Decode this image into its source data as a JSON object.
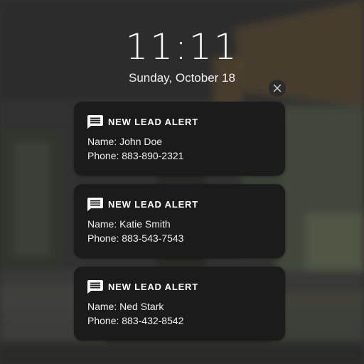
{
  "lockscreen": {
    "time": "11:11",
    "date": "Sunday, October 18"
  },
  "notifications": [
    {
      "title": "NEW LEAD ALERT",
      "name_line": "Name: John Doe",
      "phone_line": "Phone: 883-890-2321",
      "icon": "message-icon"
    },
    {
      "title": "NEW LEAD ALERT",
      "name_line": "Name: Katie Smith",
      "phone_line": "Phone: 883-543-7543",
      "icon": "message-icon"
    },
    {
      "title": "NEW LEAD ALERT",
      "name_line": "Name: Ned Stark",
      "phone_line": "Phone: 883-432-8542",
      "icon": "message-icon"
    }
  ],
  "dismiss_button": {
    "icon": "close-icon"
  },
  "colors": {
    "card_background": "#1b1b1b",
    "text": "#ffffff",
    "wallpaper_base": "#3a3a3a"
  }
}
